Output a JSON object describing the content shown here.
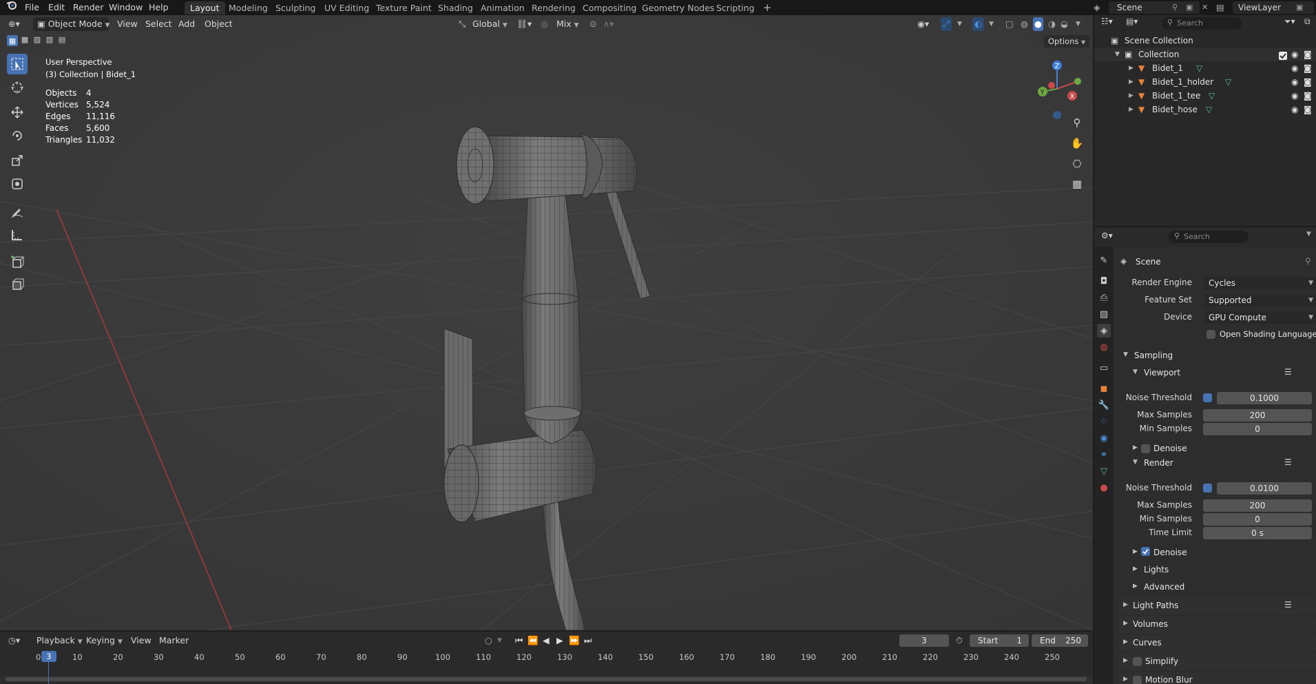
{
  "menu": [
    "File",
    "Edit",
    "Render",
    "Window",
    "Help"
  ],
  "workspaces": [
    "Layout",
    "Modeling",
    "Sculpting",
    "UV Editing",
    "Texture Paint",
    "Shading",
    "Animation",
    "Rendering",
    "Compositing",
    "Geometry Nodes",
    "Scripting"
  ],
  "active_workspace": "Layout",
  "scene_name": "Scene",
  "view_layer": "ViewLayer",
  "viewport": {
    "mode": "Object Mode",
    "menus": [
      "View",
      "Select",
      "Add",
      "Object"
    ],
    "transform_orientation": "Global",
    "pivot_label": "Mix",
    "options_label": "Options",
    "overlay_title": "User Perspective",
    "overlay_subtitle": "(3) Collection | Bidet_1",
    "stats": [
      {
        "label": "Objects",
        "value": "4"
      },
      {
        "label": "Vertices",
        "value": "5,524"
      },
      {
        "label": "Edges",
        "value": "11,116"
      },
      {
        "label": "Faces",
        "value": "5,600"
      },
      {
        "label": "Triangles",
        "value": "11,032"
      }
    ],
    "gizmo_axes": {
      "z": "Z",
      "y": "Y",
      "x": "X"
    }
  },
  "outliner": {
    "search_placeholder": "Search",
    "root": "Scene Collection",
    "collection": "Collection",
    "objects": [
      "Bidet_1",
      "Bidet_1_holder",
      "Bidet_1_tee",
      "Bidet_hose"
    ]
  },
  "properties": {
    "search_placeholder": "Search",
    "header": "Scene",
    "render_engine_label": "Render Engine",
    "render_engine": "Cycles",
    "feature_set_label": "Feature Set",
    "feature_set": "Supported",
    "device_label": "Device",
    "device": "GPU Compute",
    "osl_label": "Open Shading Language",
    "sampling": "Sampling",
    "viewport_sec": "Viewport",
    "noise_threshold_label": "Noise Threshold",
    "vp_noise": "0.1000",
    "max_samples_label": "Max Samples",
    "vp_max": "200",
    "min_samples_label": "Min Samples",
    "vp_min": "0",
    "denoise_label": "Denoise",
    "render_sec": "Render",
    "r_noise": "0.0100",
    "r_max": "200",
    "r_min": "0",
    "time_limit_label": "Time Limit",
    "r_time": "0 s",
    "lights": "Lights",
    "advanced": "Advanced",
    "light_paths": "Light Paths",
    "volumes": "Volumes",
    "curves": "Curves",
    "simplify": "Simplify",
    "motion_blur": "Motion Blur"
  },
  "timeline": {
    "menus": [
      "Playback",
      "Keying",
      "View",
      "Marker"
    ],
    "current_frame": "3",
    "start_label": "Start",
    "start": "1",
    "end_label": "End",
    "end": "250",
    "ticks": [
      "0",
      "10",
      "20",
      "30",
      "40",
      "50",
      "60",
      "70",
      "80",
      "90",
      "100",
      "110",
      "120",
      "130",
      "140",
      "150",
      "160",
      "170",
      "180",
      "190",
      "200",
      "210",
      "220",
      "230",
      "240",
      "250"
    ]
  }
}
